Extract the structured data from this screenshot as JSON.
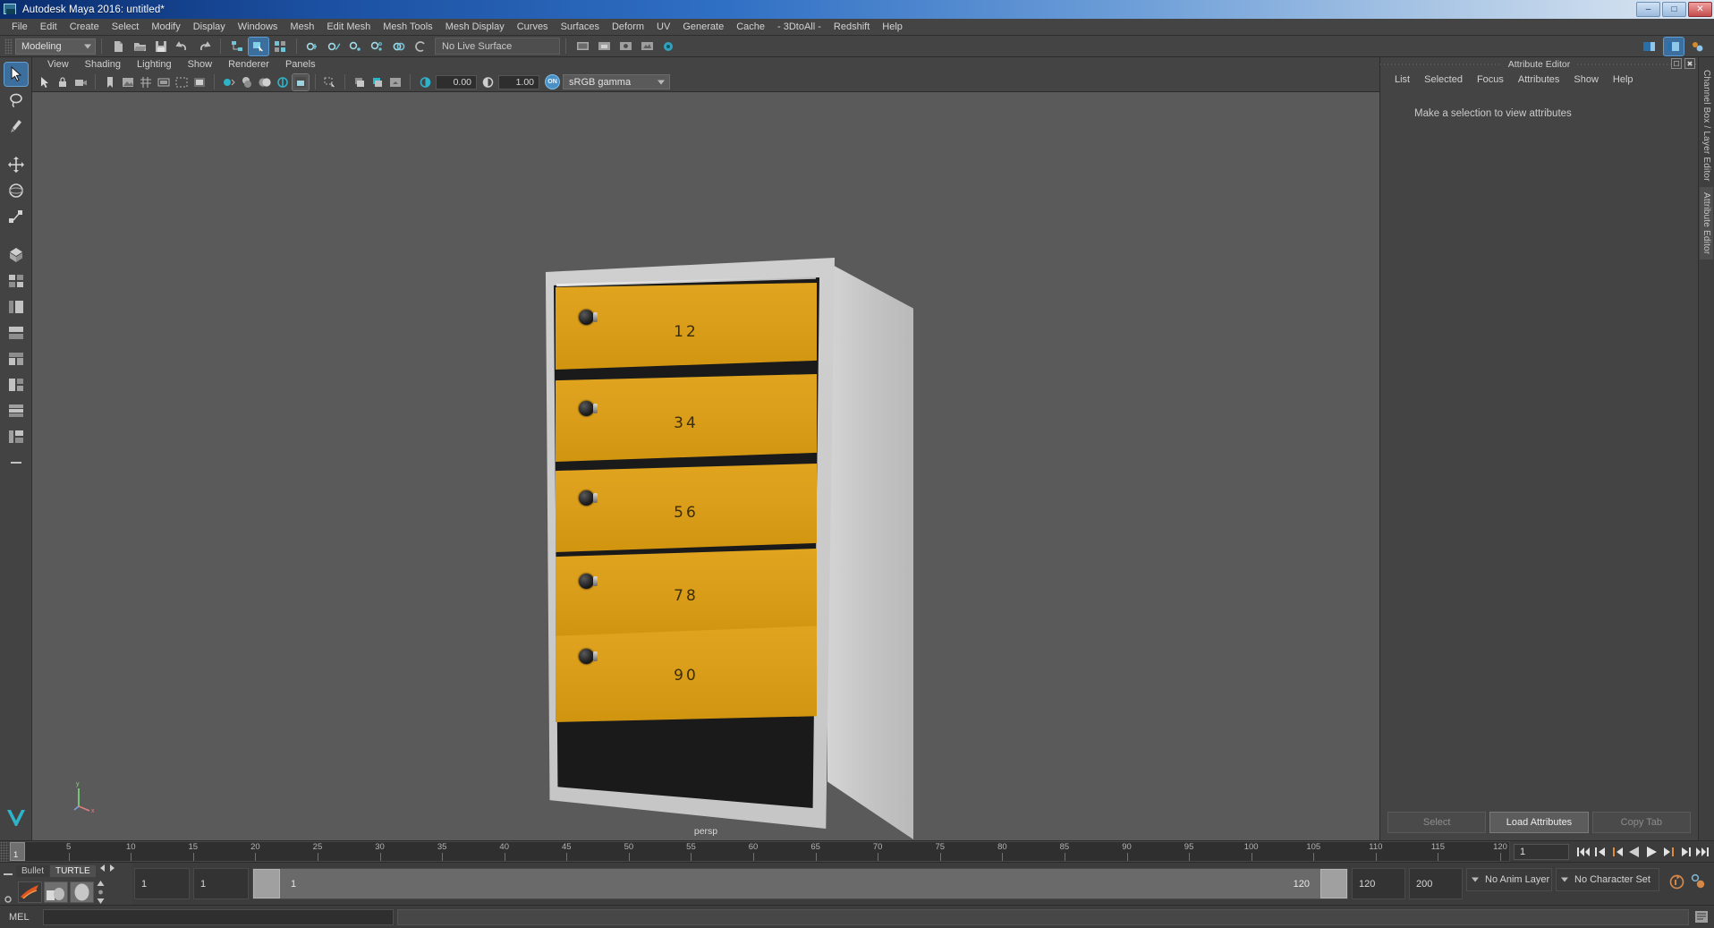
{
  "window": {
    "title": "Autodesk Maya 2016: untitled*",
    "icon": "maya-app-icon",
    "buttons": {
      "minimize": "–",
      "maximize": "□",
      "close": "✕"
    }
  },
  "main_menu": {
    "items": [
      "File",
      "Edit",
      "Create",
      "Select",
      "Modify",
      "Display",
      "Windows",
      "Mesh",
      "Edit Mesh",
      "Mesh Tools",
      "Mesh Display",
      "Curves",
      "Surfaces",
      "Deform",
      "UV",
      "Generate",
      "Cache",
      "- 3DtoAll -",
      "Redshift",
      "Help"
    ]
  },
  "status_bar": {
    "menu_set": "Modeling",
    "live_surface": "No Live Surface",
    "file_icons": [
      "new-scene-icon",
      "open-scene-icon",
      "save-scene-icon",
      "undo-icon",
      "redo-icon"
    ],
    "select_mode_icons": [
      "select-by-hierarchy-icon",
      "select-by-object-icon",
      "select-by-component-icon"
    ],
    "snap_icons": [
      "snap-to-grid-icon",
      "snap-to-curve-icon",
      "snap-to-point-icon",
      "snap-to-projected-center-icon",
      "snap-to-view-plane-icon",
      "make-live-icon"
    ],
    "editor_icons": [
      "render-view-icon",
      "render-current-frame-icon",
      "ipr-render-icon",
      "render-settings-icon",
      "hypershade-icon"
    ],
    "right_icons": [
      "sidebar-toggle-icon",
      "attribute-editor-toggle-icon",
      "tool-settings-toggle-icon"
    ]
  },
  "toolbox": {
    "tools": [
      {
        "name": "select-tool",
        "selected": true
      },
      {
        "name": "lasso-select-tool",
        "selected": false
      },
      {
        "name": "paint-select-tool",
        "selected": false
      },
      {
        "name": "move-tool",
        "selected": false
      },
      {
        "name": "rotate-tool",
        "selected": false
      },
      {
        "name": "scale-tool",
        "selected": false
      },
      {
        "name": "last-tool-used",
        "selected": false
      }
    ],
    "layouts": [
      "single-perspective-layout",
      "four-view-layout",
      "persp-outliner-layout",
      "persp-graph-layout",
      "hypershade-persp-layout",
      "persp-uv-layout",
      "outliner-persp-layout",
      "two-pane-stacked-layout",
      "more-layouts"
    ],
    "logo": "maya-logo"
  },
  "viewport": {
    "panel_menu": [
      "View",
      "Shading",
      "Lighting",
      "Show",
      "Renderer",
      "Panels"
    ],
    "camera_label": "persp",
    "toolbar": {
      "exposure_value": "0.00",
      "gamma_value": "1.00",
      "color_space": "sRGB gamma",
      "color_management_state": "ON",
      "icons": [
        "select-objects-icon",
        "lock-camera-icon",
        "camera-attributes-icon",
        "bookmarks-icon",
        "image-plane-icon",
        "two-sided-lighting-icon",
        "shadows-icon",
        "ao-icon",
        "motion-blur-icon",
        "multisample-icon",
        "grid-toggle-icon",
        "film-gate-icon",
        "resolution-gate-icon",
        "gate-mask-icon",
        "wireframe-shading-icon",
        "smooth-shade-all-icon",
        "shaded-and-textured-icon",
        "use-all-lights-icon",
        "xray-icon",
        "xray-joints-icon",
        "isolate-select-icon",
        "exposure-icon",
        "contrast-icon"
      ]
    },
    "axis_gizmo": {
      "x": "x",
      "y": "y",
      "z": "z"
    }
  },
  "scene": {
    "object": "mailbox-cabinet",
    "drawer_labels": [
      "12",
      "34",
      "56",
      "78",
      "90"
    ],
    "colors": {
      "drawer_front": "#dc9f1c",
      "cabinet_body": "#c9c9c9",
      "viewport_background": "#5a5a5a",
      "knob": "#1c1c1c"
    }
  },
  "attribute_editor": {
    "title": "Attribute Editor",
    "menu": [
      "List",
      "Selected",
      "Focus",
      "Attributes",
      "Show",
      "Help"
    ],
    "empty_message": "Make a selection to view attributes",
    "footer_buttons": [
      "Select",
      "Load Attributes",
      "Copy Tab"
    ],
    "titlebar_buttons": [
      "undock-panel-icon",
      "close-panel-icon"
    ]
  },
  "right_tabs": {
    "items": [
      "Channel Box / Layer Editor",
      "Attribute Editor"
    ]
  },
  "time_slider": {
    "current_frame": "1",
    "cursor_label": "1",
    "ticks": [
      5,
      10,
      15,
      20,
      25,
      30,
      35,
      40,
      45,
      50,
      55,
      60,
      65,
      70,
      75,
      80,
      85,
      90,
      95,
      100,
      105,
      110,
      115,
      120
    ],
    "start": 1,
    "end": 120,
    "playback_buttons": [
      "go-to-start-icon",
      "step-back-frame-icon",
      "step-back-key-icon",
      "play-backwards-icon",
      "play-forwards-icon",
      "step-forward-key-icon",
      "step-forward-frame-icon",
      "go-to-end-icon"
    ]
  },
  "range_slider": {
    "anim_start": "1",
    "range_start": "1",
    "bar_start_label": "1",
    "bar_end_label": "120",
    "range_end": "120",
    "anim_end": "200",
    "anim_layer": "No Anim Layer",
    "character_set": "No Character Set",
    "right_icons": [
      "auto-key-icon",
      "animation-preferences-icon"
    ]
  },
  "shelf": {
    "tabs": [
      "Bullet",
      "TURTLE"
    ],
    "selected_tab": "TURTLE",
    "arrows": [
      "shelf-prev-icon",
      "shelf-next-icon"
    ],
    "icons": [
      "turtle-render-icon",
      "turtle-bake-icon",
      "turtle-sphere-icon"
    ],
    "side_icons": [
      "shelf-menu-icon",
      "shelf-options-icon"
    ]
  },
  "command_line": {
    "label": "MEL",
    "input_value": "",
    "output_value": "",
    "script_editor_icon": "script-editor-icon"
  }
}
